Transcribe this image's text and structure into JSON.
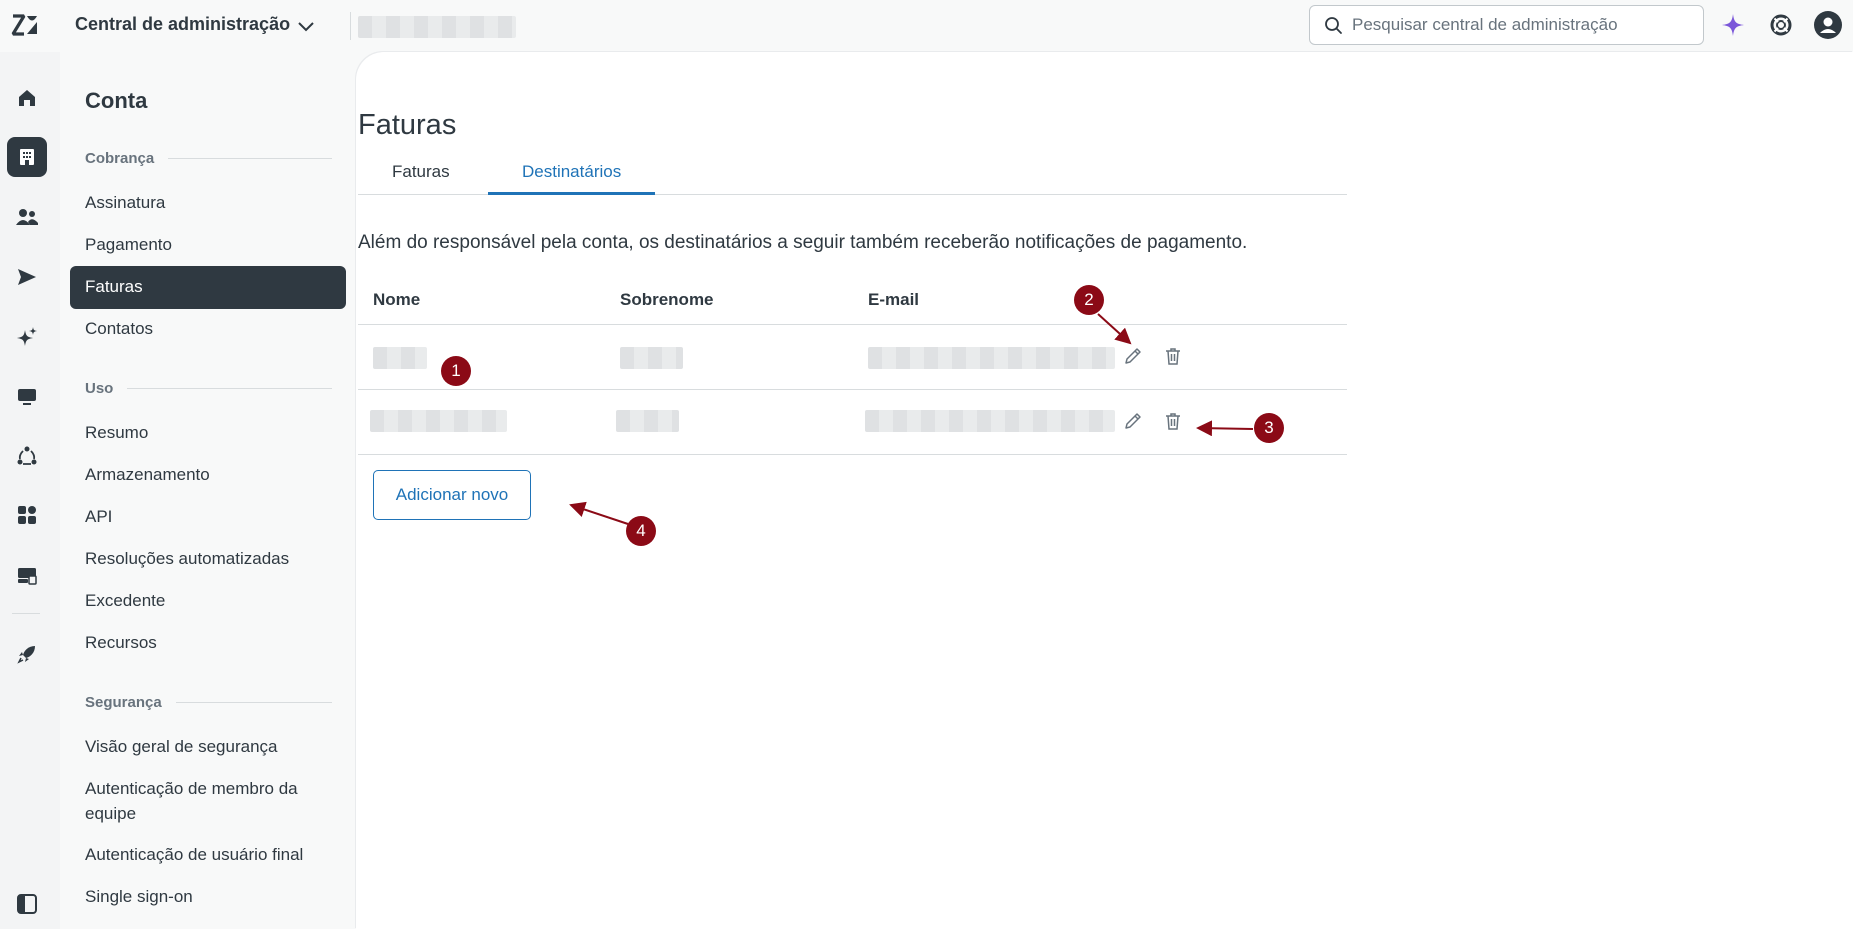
{
  "header": {
    "app_title": "Central de administração",
    "search_placeholder": "Pesquisar central de administração"
  },
  "rail": {
    "items": [
      "home-icon",
      "building-icon",
      "people-icon",
      "send-icon",
      "sparkle-icon",
      "monitor-icon",
      "nodes-icon",
      "apps-icon",
      "server-icon",
      "rocket-icon",
      "panel-toggle-icon"
    ]
  },
  "sidebar": {
    "title": "Conta",
    "sections": [
      {
        "label": "Cobrança",
        "items": [
          "Assinatura",
          "Pagamento",
          "Faturas",
          "Contatos"
        ]
      },
      {
        "label": "Uso",
        "items": [
          "Resumo",
          "Armazenamento",
          "API",
          "Resoluções automatizadas",
          "Excedente",
          "Recursos"
        ]
      },
      {
        "label": "Segurança",
        "items": [
          "Visão geral de segurança",
          "Autenticação de membro da equipe",
          "Autenticação de usuário final",
          "Single sign-on"
        ]
      }
    ],
    "active_item": "Faturas"
  },
  "main": {
    "title": "Faturas",
    "tabs": [
      {
        "label": "Faturas",
        "active": false
      },
      {
        "label": "Destinatários",
        "active": true
      }
    ],
    "description": "Além do responsável pela conta, os destinatários a seguir também receberão notificações de pagamento.",
    "table": {
      "headers": [
        "Nome",
        "Sobrenome",
        "E-mail"
      ],
      "rows": [
        {
          "nome": "",
          "sobrenome": "",
          "email": ""
        },
        {
          "nome": "",
          "sobrenome": "",
          "email": ""
        }
      ]
    },
    "add_button": "Adicionar novo"
  },
  "annotations": {
    "labels": [
      "1",
      "2",
      "3",
      "4"
    ],
    "color": "#8b0a16"
  },
  "colors": {
    "accent": "#1f73b7",
    "active_nav": "#2f3941",
    "ai_sparkle": "#7b57d9"
  }
}
